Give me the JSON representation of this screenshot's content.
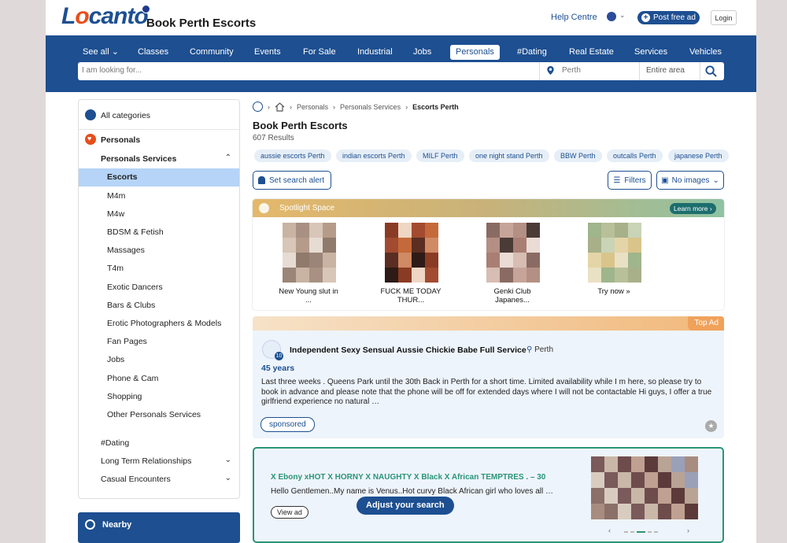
{
  "brand": {
    "logo": "Locanto",
    "site_title": "Book Perth Escorts"
  },
  "header": {
    "help": "Help Centre",
    "post_ad": "Post free ad",
    "login": "Login"
  },
  "nav": {
    "items": [
      {
        "label": "See all ⌄"
      },
      {
        "label": "Classes"
      },
      {
        "label": "Community"
      },
      {
        "label": "Events"
      },
      {
        "label": "For Sale"
      },
      {
        "label": "Industrial"
      },
      {
        "label": "Jobs"
      },
      {
        "label": "Personals"
      },
      {
        "label": "#Dating"
      },
      {
        "label": "Real Estate"
      },
      {
        "label": "Services"
      },
      {
        "label": "Vehicles"
      }
    ],
    "active": "Personals"
  },
  "search": {
    "placeholder": "I am looking for...",
    "location": "Perth",
    "area": "Entire area"
  },
  "sidebar": {
    "all_categories": "All categories",
    "personals": "Personals",
    "personals_services": "Personals Services",
    "subitems": [
      "Escorts",
      "M4m",
      "M4w",
      "BDSM & Fetish",
      "Massages",
      "T4m",
      "Exotic Dancers",
      "Bars & Clubs",
      "Erotic Photographers & Models",
      "Fan Pages",
      "Jobs",
      "Phone & Cam",
      "Shopping",
      "Other Personals Services"
    ],
    "dating": "#Dating",
    "long_term": "Long Term Relationships",
    "casual": "Casual Encounters",
    "nearby": "Nearby"
  },
  "breadcrumb": {
    "c1": "Personals",
    "c2": "Personals Services",
    "c3": "Escorts Perth"
  },
  "main": {
    "title": "Book Perth Escorts",
    "results": "607 Results",
    "tags": [
      "aussie escorts Perth",
      "indian escorts Perth",
      "MILF Perth",
      "one night stand Perth",
      "BBW Perth",
      "outcalls Perth",
      "japanese Perth"
    ],
    "set_alert": "Set search alert",
    "filters": "Filters",
    "no_images": "No images"
  },
  "spotlight": {
    "title": "Spotlight Space",
    "learn_more": "Learn more ›",
    "items": [
      {
        "caption_1": "New Young slut in",
        "caption_2": "..."
      },
      {
        "caption_1": "FUCK ME TODAY",
        "caption_2": "THUR..."
      },
      {
        "caption_1": "Genki Club",
        "caption_2": "Japanes..."
      },
      {
        "caption_1": "Try now »",
        "caption_2": ""
      }
    ]
  },
  "top_ad": {
    "label": "Top Ad",
    "photo_count": "10",
    "title": "Independent Sexy Sensual Aussie Chickie Babe Full Service",
    "location": "Perth",
    "age": "45 years",
    "description": "Last three weeks . Queens Park until the 30th Back in Perth for a short time. Limited availability while I m here, so please try to book in advance and please note that the phone will be off for extended days where I will not be contactable Hi guys, I offer a true girlfriend experience no natural …",
    "sponsored": "sponsored"
  },
  "ad2": {
    "title": "X Ebony xHOT X HORNY X NAUGHTY X Black X African TEMPTRES . – 30",
    "description": "Hello Gentlemen..My name is Venus..Hot curvy Black African girl who loves all …",
    "view": "View ad",
    "adjust": "Adjust your search"
  },
  "colors": {
    "brand_blue": "#1d4f91",
    "accent_orange": "#e84e1b",
    "green": "#2a9477"
  }
}
